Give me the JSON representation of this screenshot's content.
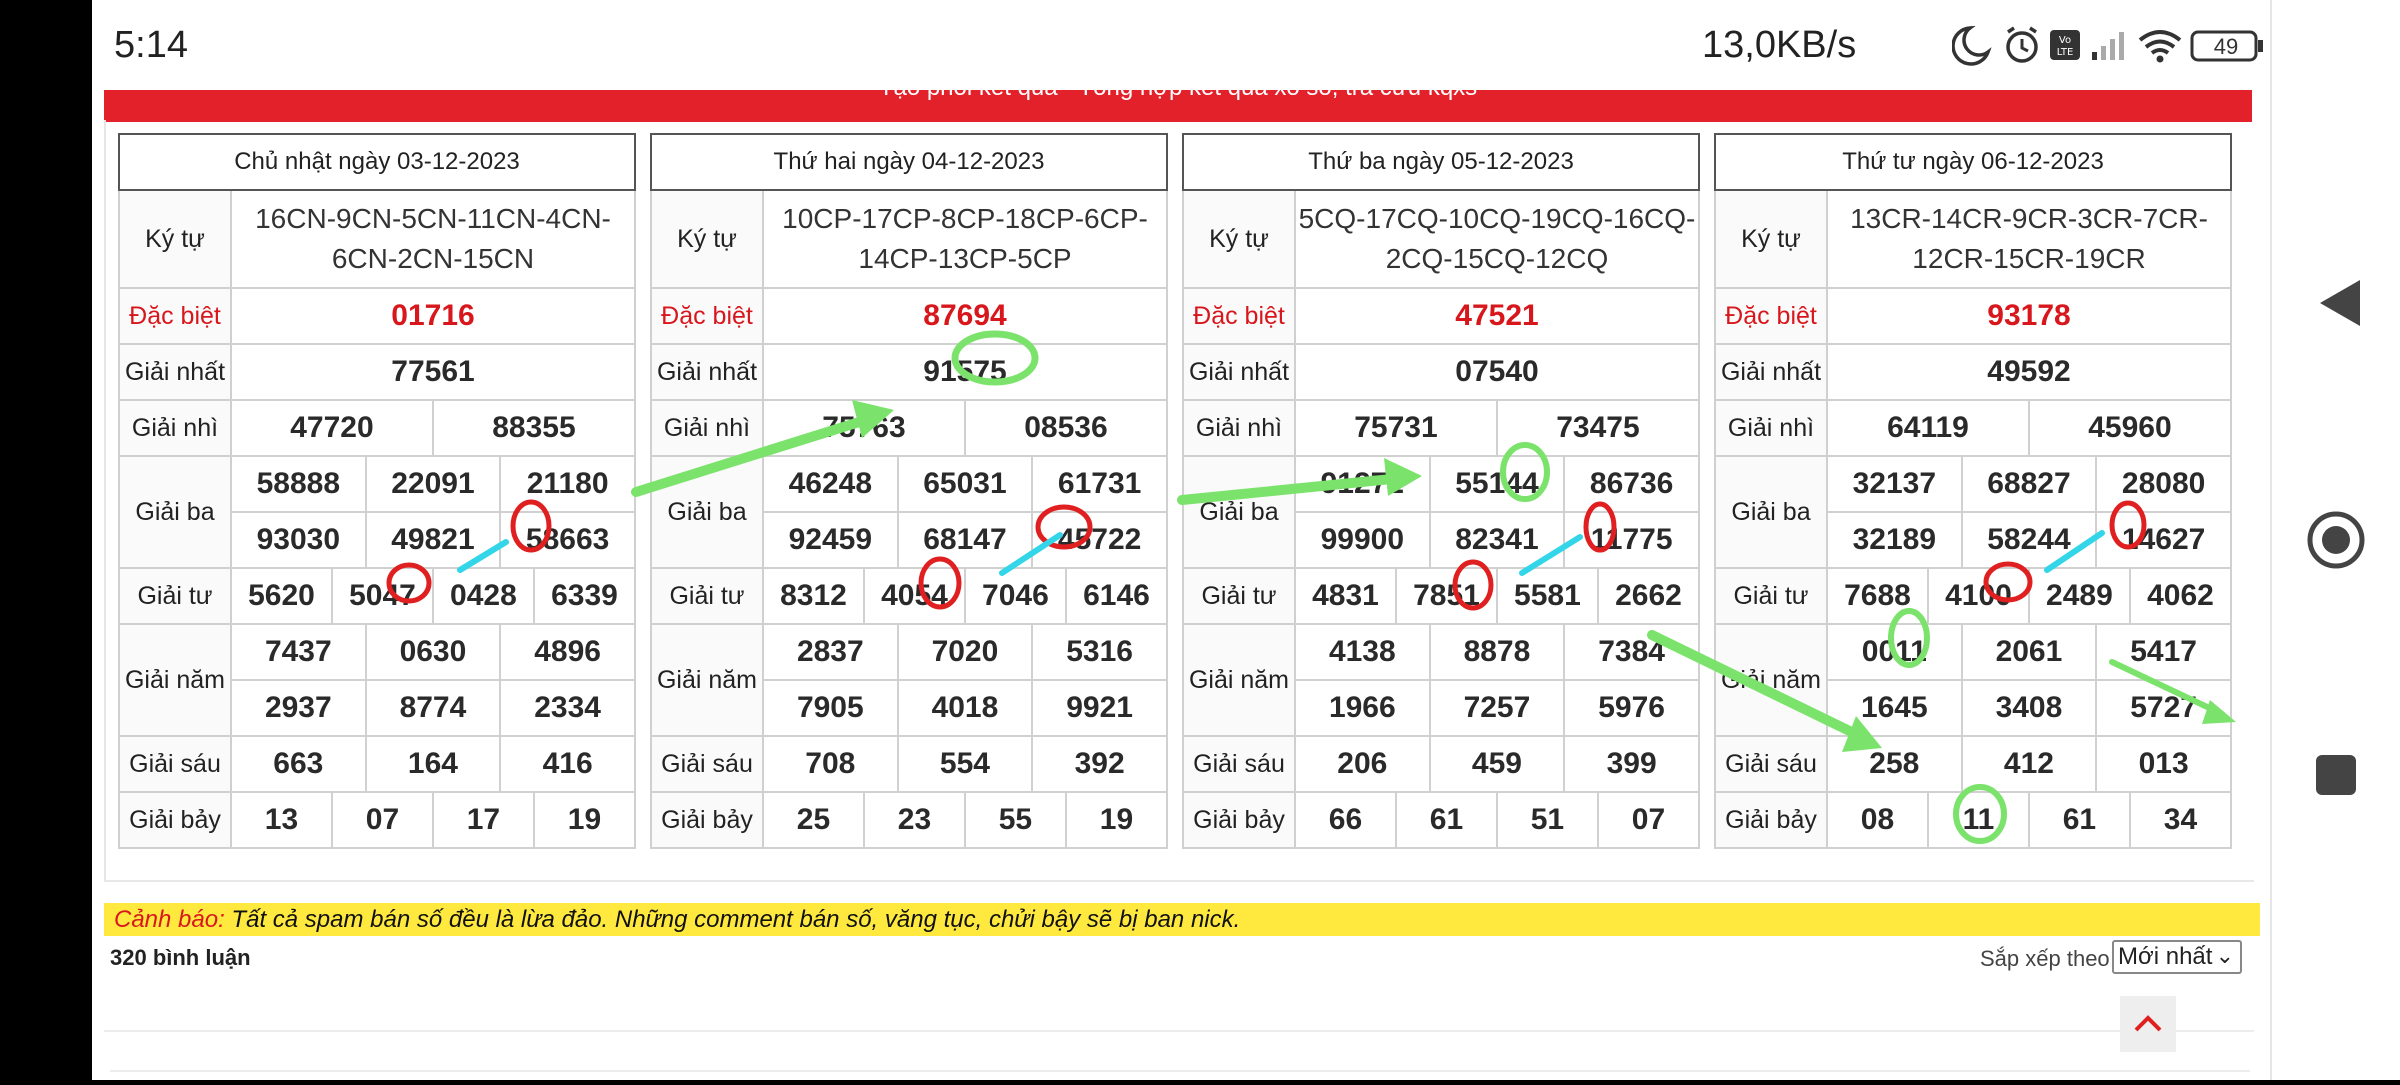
{
  "status": {
    "time": "5:14",
    "speed": "13,0KB/s",
    "battery": "49"
  },
  "banner": "Tạo phôi kết quả - Tổng hợp kết quả xổ số, tra cứu kqxs",
  "labels": {
    "kytu": "Ký tự",
    "db": "Đặc biệt",
    "g1": "Giải nhất",
    "g2": "Giải nhì",
    "g3": "Giải ba",
    "g4": "Giải tư",
    "g5": "Giải năm",
    "g6": "Giải sáu",
    "g7": "Giải bảy"
  },
  "tables": [
    {
      "date": "Chủ nhật ngày 03-12-2023",
      "kytu": [
        "16CN-9CN-5CN-11CN-4CN-",
        "6CN-2CN-15CN"
      ],
      "db": "01716",
      "g1": "77561",
      "g2": [
        "47720",
        "88355"
      ],
      "g3": [
        "58888",
        "22091",
        "21180",
        "93030",
        "49821",
        "58663"
      ],
      "g4": [
        "5620",
        "5047",
        "0428",
        "6339"
      ],
      "g5": [
        "7437",
        "0630",
        "4896",
        "2937",
        "8774",
        "2334"
      ],
      "g6": [
        "663",
        "164",
        "416"
      ],
      "g7": [
        "13",
        "07",
        "17",
        "19"
      ]
    },
    {
      "date": "Thứ hai ngày 04-12-2023",
      "kytu": [
        "10CP-17CP-8CP-18CP-6CP-",
        "14CP-13CP-5CP"
      ],
      "db": "87694",
      "g1": "91575",
      "g2": [
        "75763",
        "08536"
      ],
      "g3": [
        "46248",
        "65031",
        "61731",
        "92459",
        "68147",
        "45722"
      ],
      "g4": [
        "8312",
        "4054",
        "7046",
        "6146"
      ],
      "g5": [
        "2837",
        "7020",
        "5316",
        "7905",
        "4018",
        "9921"
      ],
      "g6": [
        "708",
        "554",
        "392"
      ],
      "g7": [
        "25",
        "23",
        "55",
        "19"
      ]
    },
    {
      "date": "Thứ ba ngày 05-12-2023",
      "kytu": [
        "5CQ-17CQ-10CQ-19CQ-16CQ-",
        "2CQ-15CQ-12CQ"
      ],
      "db": "47521",
      "g1": "07540",
      "g2": [
        "75731",
        "73475"
      ],
      "g3": [
        "91272",
        "55144",
        "86736",
        "99900",
        "82341",
        "11775"
      ],
      "g4": [
        "4831",
        "7851",
        "5581",
        "2662"
      ],
      "g5": [
        "4138",
        "8878",
        "7384",
        "1966",
        "7257",
        "5976"
      ],
      "g6": [
        "206",
        "459",
        "399"
      ],
      "g7": [
        "66",
        "61",
        "51",
        "07"
      ]
    },
    {
      "date": "Thứ tư ngày 06-12-2023",
      "kytu": [
        "13CR-14CR-9CR-3CR-7CR-",
        "12CR-15CR-19CR"
      ],
      "db": "93178",
      "g1": "49592",
      "g2": [
        "64119",
        "45960"
      ],
      "g3": [
        "32137",
        "68827",
        "28080",
        "32189",
        "58244",
        "14627"
      ],
      "g4": [
        "7688",
        "4100",
        "2489",
        "4062"
      ],
      "g5": [
        "0011",
        "2061",
        "5417",
        "1645",
        "3408",
        "5727"
      ],
      "g6": [
        "258",
        "412",
        "013"
      ],
      "g7": [
        "08",
        "11",
        "61",
        "34"
      ]
    }
  ],
  "warning": {
    "label": "Cảnh báo:",
    "text": " Tất cả spam bán số đều là lừa đảo. Những comment bán số, văng tục, chửi bậy sẽ bị ban nick."
  },
  "comments_count": "320 bình luận",
  "sort": {
    "label": "Sắp xếp theo",
    "value": "Mới nhất"
  },
  "colors": {
    "accent_red": "#d8171d",
    "banner": "#e3212b",
    "warning_bg": "#ffe93f",
    "mark_green": "#7be36b",
    "mark_cyan": "#33d6e8"
  }
}
